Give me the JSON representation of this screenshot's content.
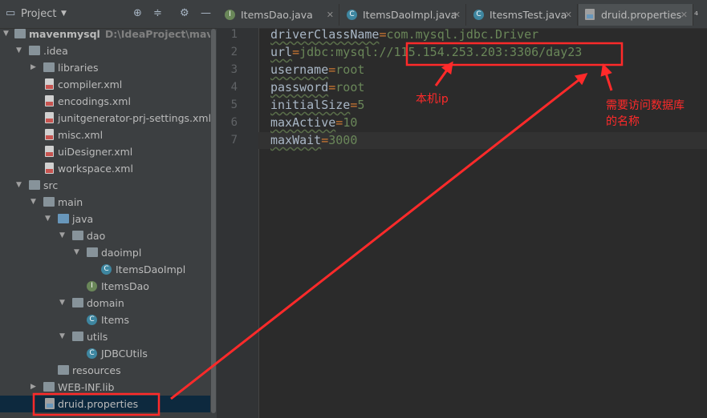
{
  "panel": {
    "title": "Project",
    "root_name": "mavenmysql",
    "root_path": "D:\\IdeaProject\\mavenmysql",
    "tree": [
      {
        "label": "mavenmysql",
        "kind": "folder"
      },
      {
        "label": ".idea",
        "kind": "folder"
      },
      {
        "label": "libraries",
        "kind": "folder"
      },
      {
        "label": "compiler.xml",
        "kind": "xml"
      },
      {
        "label": "encodings.xml",
        "kind": "xml"
      },
      {
        "label": "junitgenerator-prj-settings.xml",
        "kind": "xml"
      },
      {
        "label": "misc.xml",
        "kind": "xml"
      },
      {
        "label": "uiDesigner.xml",
        "kind": "xml"
      },
      {
        "label": "workspace.xml",
        "kind": "xml"
      },
      {
        "label": "src",
        "kind": "folder"
      },
      {
        "label": "main",
        "kind": "folder"
      },
      {
        "label": "java",
        "kind": "folder"
      },
      {
        "label": "dao",
        "kind": "package"
      },
      {
        "label": "daoimpl",
        "kind": "package"
      },
      {
        "label": "ItemsDaoImpl",
        "kind": "class"
      },
      {
        "label": "ItemsDao",
        "kind": "interface"
      },
      {
        "label": "domain",
        "kind": "package"
      },
      {
        "label": "Items",
        "kind": "class"
      },
      {
        "label": "utils",
        "kind": "package"
      },
      {
        "label": "JDBCUtils",
        "kind": "class"
      },
      {
        "label": "resources",
        "kind": "folder"
      },
      {
        "label": "WEB-INF.lib",
        "kind": "folder"
      },
      {
        "label": "druid.properties",
        "kind": "properties"
      }
    ]
  },
  "tabs": [
    {
      "label": "ItemsDao.java",
      "type": "interface"
    },
    {
      "label": "ItemsDaoImpl.java",
      "type": "class"
    },
    {
      "label": "ItesmsTest.java",
      "type": "class"
    },
    {
      "label": "druid.properties",
      "type": "properties"
    }
  ],
  "tab_overflow": "⁴",
  "editor": {
    "line_numbers": [
      "1",
      "2",
      "3",
      "4",
      "5",
      "6",
      "7"
    ],
    "lines": [
      {
        "key": "driverClassName",
        "value": "com.mysql.jdbc.Driver"
      },
      {
        "key": "url",
        "value": "jdbc:mysql://115.154.253.203:3306/day23"
      },
      {
        "key": "username",
        "value": "root"
      },
      {
        "key": "password",
        "value": "root"
      },
      {
        "key": "initialSize",
        "value": "5"
      },
      {
        "key": "maxActive",
        "value": "10"
      },
      {
        "key": "maxWait",
        "value": "3000"
      }
    ]
  },
  "annotations": {
    "local_ip": "本机ip",
    "db_name_line1": "需要访问数据库",
    "db_name_line2": "的名称"
  },
  "colors": {
    "annotation": "#ff2a2a",
    "key": "#a9b7c6",
    "value": "#6a8759",
    "equals": "#cc7832"
  }
}
